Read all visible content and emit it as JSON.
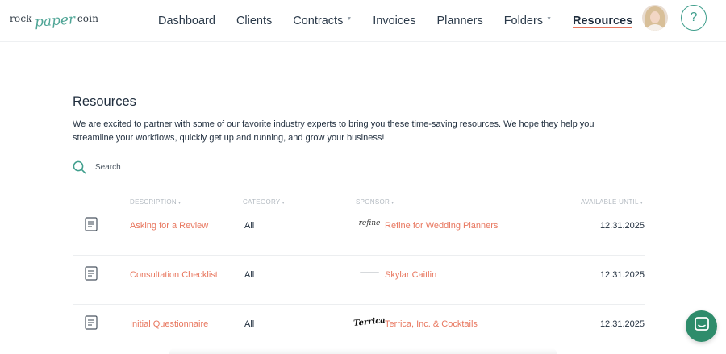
{
  "logo": {
    "word1": "rock",
    "word2": "paper",
    "word3": "coin"
  },
  "nav": {
    "items": [
      {
        "label": "Dashboard",
        "dropdown": false,
        "active": false
      },
      {
        "label": "Clients",
        "dropdown": false,
        "active": false
      },
      {
        "label": "Contracts",
        "dropdown": true,
        "active": false
      },
      {
        "label": "Invoices",
        "dropdown": false,
        "active": false
      },
      {
        "label": "Planners",
        "dropdown": false,
        "active": false
      },
      {
        "label": "Folders",
        "dropdown": true,
        "active": false
      },
      {
        "label": "Resources",
        "dropdown": false,
        "active": true
      }
    ],
    "help_label": "?"
  },
  "page": {
    "title": "Resources",
    "intro": "We are excited to partner with some of our favorite industry experts to bring you these time-saving resources. We hope they help you streamline your workflows, quickly get up and running, and grow your business!"
  },
  "search": {
    "placeholder": "Search",
    "value": ""
  },
  "table": {
    "headers": {
      "description": "DESCRIPTION",
      "category": "CATEGORY",
      "sponsor": "SPONSOR",
      "available_until": "AVAILABLE UNTIL"
    },
    "rows": [
      {
        "description": "Asking for a Review",
        "category": "All",
        "sponsor_logo": "refine",
        "sponsor": "Refine for Wedding Planners",
        "available_until": "12.31.2025"
      },
      {
        "description": "Consultation Checklist",
        "category": "All",
        "sponsor_logo": "",
        "sponsor": "Skylar Caitlin",
        "available_until": "12.31.2025"
      },
      {
        "description": "Initial Questionnaire",
        "category": "All",
        "sponsor_logo": "Terrica",
        "sponsor": "Terrica, Inc. & Cocktails",
        "available_until": "12.31.2025"
      }
    ]
  },
  "icons": {
    "search": "search-icon",
    "document": "document-icon",
    "chat": "chat-icon",
    "help": "help-icon"
  },
  "colors": {
    "accent_coral": "#e8775f",
    "accent_green": "#3f9e8c",
    "chat_green": "#2e8c6b",
    "text_dark": "#1f2d3d",
    "header_gray": "#b3bac1"
  }
}
